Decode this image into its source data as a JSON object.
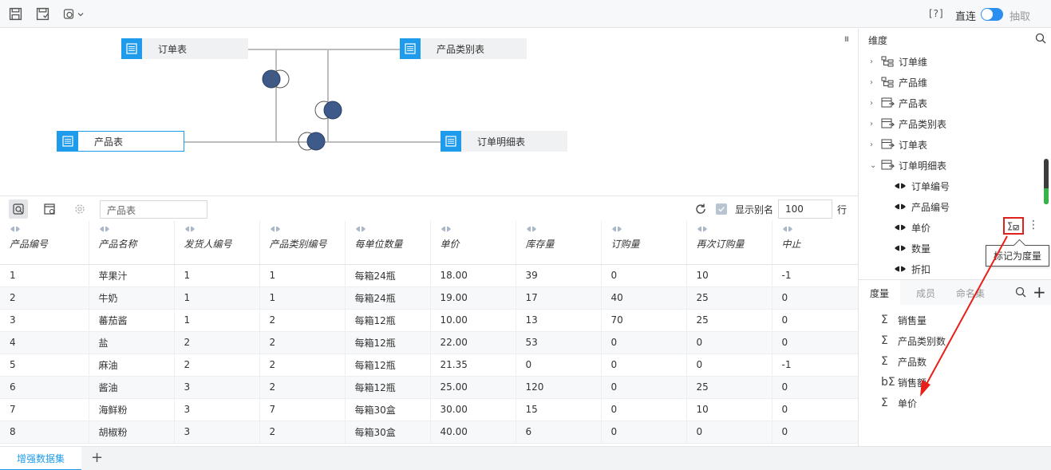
{
  "toolbar": {
    "help": "[?]",
    "direct": "直连",
    "extract": "抽取"
  },
  "diagram": {
    "nodes": [
      {
        "label": "订单表"
      },
      {
        "label": "产品类别表"
      },
      {
        "label": "产品表"
      },
      {
        "label": "订单明细表"
      }
    ],
    "collapse": "III"
  },
  "preview": {
    "table_name": "产品表",
    "show_alias_label": "显示别名",
    "rows_value": "100",
    "rows_unit": "行",
    "columns": [
      "产品编号",
      "产品名称",
      "发货人编号",
      "产品类别编号",
      "每单位数量",
      "单价",
      "库存量",
      "订购量",
      "再次订购量",
      "中止"
    ],
    "rows": [
      [
        "1",
        "苹果汁",
        "1",
        "1",
        "每箱24瓶",
        "18.00",
        "39",
        "0",
        "10",
        "-1"
      ],
      [
        "2",
        "牛奶",
        "1",
        "1",
        "每箱24瓶",
        "19.00",
        "17",
        "40",
        "25",
        "0"
      ],
      [
        "3",
        "蕃茄酱",
        "1",
        "2",
        "每箱12瓶",
        "10.00",
        "13",
        "70",
        "25",
        "0"
      ],
      [
        "4",
        "盐",
        "2",
        "2",
        "每箱12瓶",
        "22.00",
        "53",
        "0",
        "0",
        "0"
      ],
      [
        "5",
        "麻油",
        "2",
        "2",
        "每箱12瓶",
        "21.35",
        "0",
        "0",
        "0",
        "-1"
      ],
      [
        "6",
        "酱油",
        "3",
        "2",
        "每箱12瓶",
        "25.00",
        "120",
        "0",
        "25",
        "0"
      ],
      [
        "7",
        "海鲜粉",
        "3",
        "7",
        "每箱30盒",
        "30.00",
        "15",
        "0",
        "10",
        "0"
      ],
      [
        "8",
        "胡椒粉",
        "3",
        "2",
        "每箱30盒",
        "40.00",
        "6",
        "0",
        "0",
        "0"
      ]
    ]
  },
  "dimension": {
    "title": "维度",
    "items": [
      {
        "label": "订单维",
        "icon": "hierarchy-icon"
      },
      {
        "label": "产品维",
        "icon": "hierarchy-icon"
      },
      {
        "label": "产品表",
        "icon": "table-link-icon"
      },
      {
        "label": "产品类别表",
        "icon": "table-link-icon"
      },
      {
        "label": "订单表",
        "icon": "table-link-icon"
      },
      {
        "label": "订单明细表",
        "icon": "table-link-icon",
        "expanded": true
      }
    ],
    "children": [
      "订单编号",
      "产品编号",
      "单价",
      "数量",
      "折扣"
    ],
    "tooltip": "标记为度量"
  },
  "measures": {
    "tabs": [
      "度量",
      "成员",
      "命名集"
    ],
    "items": [
      {
        "label": "销售量",
        "icon": "Σ"
      },
      {
        "label": "产品类别数",
        "icon": "Σ"
      },
      {
        "label": "产品数",
        "icon": "Σ"
      },
      {
        "label": "销售额",
        "icon": "bΣ"
      },
      {
        "label": "单价",
        "icon": "Σ"
      }
    ]
  },
  "bottom": {
    "tab": "增强数据集",
    "add": "+"
  }
}
